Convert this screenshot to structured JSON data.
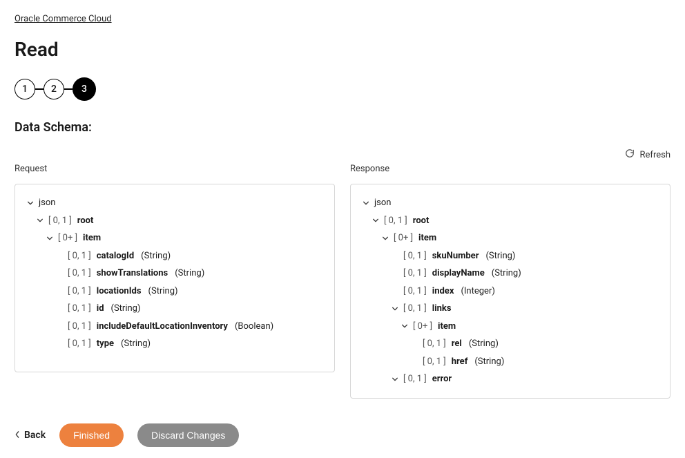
{
  "breadcrumb": "Oracle Commerce Cloud",
  "page_title": "Read",
  "stepper": {
    "steps": [
      "1",
      "2",
      "3"
    ],
    "active_index": 2
  },
  "section_title": "Data Schema:",
  "refresh_label": "Refresh",
  "request": {
    "header": "Request",
    "root_label": "json",
    "tree": [
      {
        "card": "[ 0, 1 ]",
        "name": "root",
        "expandable": true,
        "children": [
          {
            "card": "[ 0+ ]",
            "name": "item",
            "expandable": true,
            "children": [
              {
                "card": "[ 0, 1 ]",
                "name": "catalogId",
                "type": "(String)"
              },
              {
                "card": "[ 0, 1 ]",
                "name": "showTranslations",
                "type": "(String)"
              },
              {
                "card": "[ 0, 1 ]",
                "name": "locationIds",
                "type": "(String)"
              },
              {
                "card": "[ 0, 1 ]",
                "name": "id",
                "type": "(String)"
              },
              {
                "card": "[ 0, 1 ]",
                "name": "includeDefaultLocationInventory",
                "type": "(Boolean)"
              },
              {
                "card": "[ 0, 1 ]",
                "name": "type",
                "type": "(String)"
              }
            ]
          }
        ]
      }
    ]
  },
  "response": {
    "header": "Response",
    "root_label": "json",
    "tree": [
      {
        "card": "[ 0, 1 ]",
        "name": "root",
        "expandable": true,
        "children": [
          {
            "card": "[ 0+ ]",
            "name": "item",
            "expandable": true,
            "children": [
              {
                "card": "[ 0, 1 ]",
                "name": "skuNumber",
                "type": "(String)"
              },
              {
                "card": "[ 0, 1 ]",
                "name": "displayName",
                "type": "(String)"
              },
              {
                "card": "[ 0, 1 ]",
                "name": "index",
                "type": "(Integer)"
              },
              {
                "card": "[ 0, 1 ]",
                "name": "links",
                "expandable": true,
                "children": [
                  {
                    "card": "[ 0+ ]",
                    "name": "item",
                    "expandable": true,
                    "children": [
                      {
                        "card": "[ 0, 1 ]",
                        "name": "rel",
                        "type": "(String)"
                      },
                      {
                        "card": "[ 0, 1 ]",
                        "name": "href",
                        "type": "(String)"
                      }
                    ]
                  }
                ]
              },
              {
                "card": "[ 0, 1 ]",
                "name": "error",
                "expandable": true,
                "collapsed": true
              }
            ]
          }
        ]
      }
    ]
  },
  "footer": {
    "back": "Back",
    "finished": "Finished",
    "discard": "Discard Changes"
  }
}
